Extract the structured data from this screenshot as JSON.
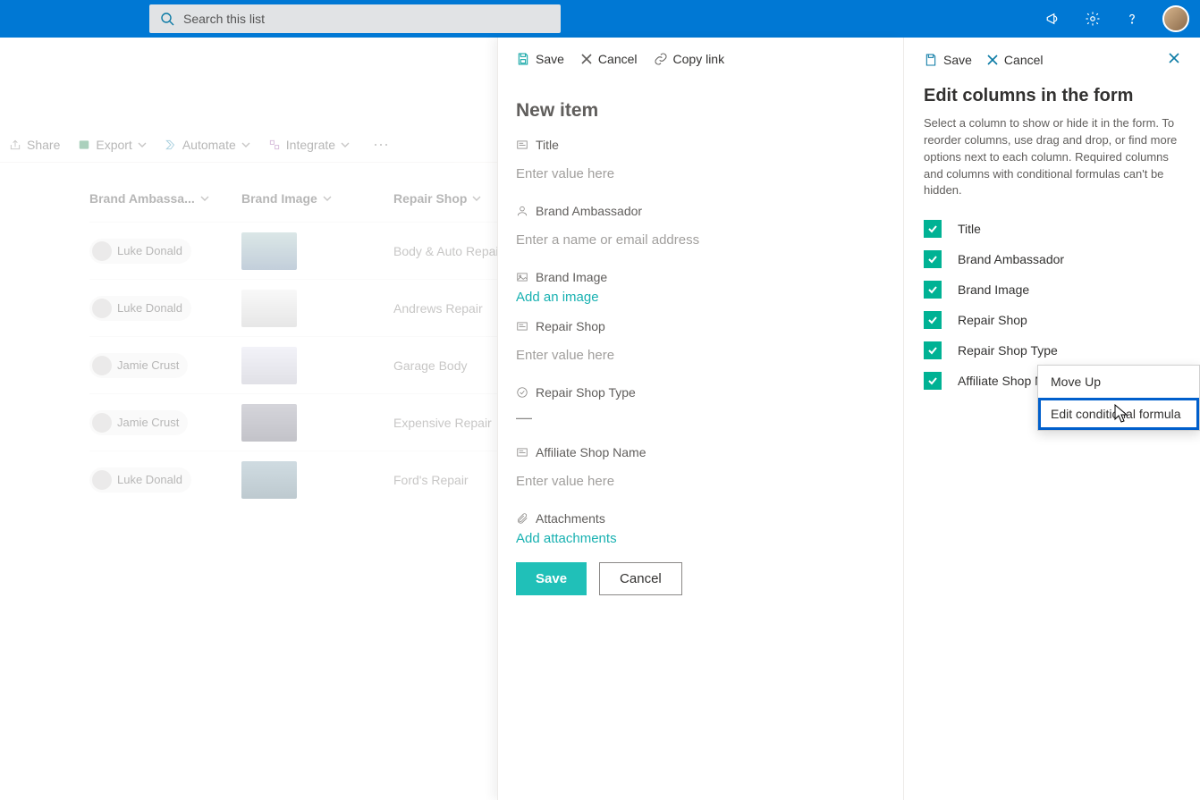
{
  "suite": {
    "search_placeholder": "Search this list"
  },
  "cmdbar": {
    "share": "Share",
    "export": "Export",
    "automate": "Automate",
    "integrate": "Integrate"
  },
  "columns": {
    "brand_ambassador": "Brand Ambassa...",
    "brand_image": "Brand Image",
    "repair_shop": "Repair Shop"
  },
  "list_rows": [
    {
      "person": "Luke Donald",
      "repair": "Body & Auto Repair"
    },
    {
      "person": "Luke Donald",
      "repair": "Andrews Repair"
    },
    {
      "person": "Jamie Crust",
      "repair": "Garage Body"
    },
    {
      "person": "Jamie Crust",
      "repair": "Expensive Repair"
    },
    {
      "person": "Luke Donald",
      "repair": "Ford's Repair"
    }
  ],
  "form_panel": {
    "top_save": "Save",
    "top_cancel": "Cancel",
    "top_copy": "Copy link",
    "title": "New item",
    "field_title": "Title",
    "ph_title": "Enter value here",
    "field_ba": "Brand Ambassador",
    "ph_ba": "Enter a name or email address",
    "field_bi": "Brand Image",
    "add_image": "Add an image",
    "field_rs": "Repair Shop",
    "ph_rs": "Enter value here",
    "field_rst": "Repair Shop Type",
    "rst_value": "—",
    "field_asn": "Affiliate Shop Name",
    "ph_asn": "Enter value here",
    "field_att": "Attachments",
    "add_att": "Add attachments",
    "save_btn": "Save",
    "cancel_btn": "Cancel"
  },
  "right_panel": {
    "save": "Save",
    "cancel": "Cancel",
    "title": "Edit columns in the form",
    "desc": "Select a column to show or hide it in the form. To reorder columns, use drag and drop, or find more options next to each column. Required columns and columns with conditional formulas can't be hidden.",
    "cols": {
      "c0": "Title",
      "c1": "Brand Ambassador",
      "c2": "Brand Image",
      "c3": "Repair Shop",
      "c4": "Repair Shop Type",
      "c5": "Affiliate Shop Name"
    }
  },
  "ctx_menu": {
    "move_up": "Move Up",
    "edit_formula": "Edit conditional formula"
  }
}
